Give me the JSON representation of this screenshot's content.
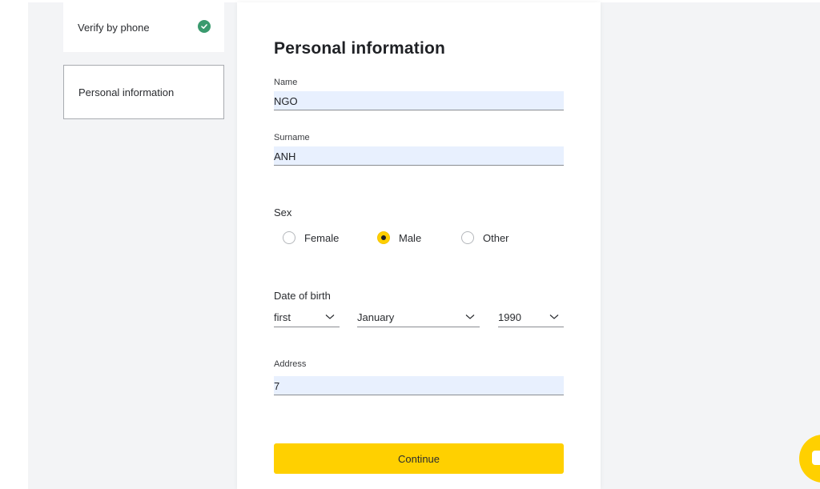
{
  "steps": {
    "verify_label": "Verify by phone",
    "personal_label": "Personal information"
  },
  "form": {
    "title": "Personal information",
    "name": {
      "label": "Name",
      "value": "NGO"
    },
    "surname": {
      "label": "Surname",
      "value": "ANH"
    },
    "sex": {
      "label": "Sex",
      "options": [
        "Female",
        "Male",
        "Other"
      ],
      "selected": "Male"
    },
    "dob": {
      "label": "Date of birth",
      "day": "first",
      "month": "January",
      "year": "1990"
    },
    "address": {
      "label": "Address",
      "value": "7"
    },
    "continue_label": "Continue"
  },
  "colors": {
    "accent": "#ffd000",
    "success": "#3a9a6e",
    "input_bg": "#e8f0fe"
  }
}
